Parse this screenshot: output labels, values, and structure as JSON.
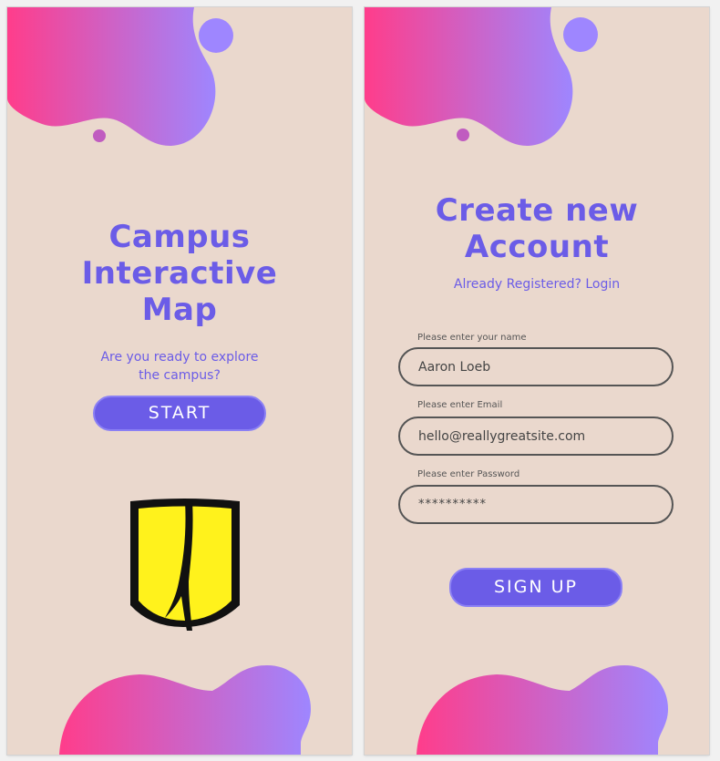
{
  "welcome_screen": {
    "title_lines": [
      "Campus",
      "Interactive",
      "Map"
    ],
    "subtitle_lines": [
      "Are you ready to explore",
      "the campus?"
    ],
    "start_button": "START",
    "logo_icon": "university-shield-logo"
  },
  "signup_screen": {
    "title_lines": [
      "Create new",
      "Account"
    ],
    "login_link": "Already Registered? Login",
    "fields": [
      {
        "label": "Please enter your name",
        "value": "Aaron Loeb"
      },
      {
        "label": "Please enter Email",
        "value": "hello@reallygreatsite.com"
      },
      {
        "label": "Please enter Password",
        "value": "**********"
      }
    ],
    "signup_button": "SIGN UP"
  },
  "colors": {
    "background": "#ead8cd",
    "accent": "#6b5ce7",
    "gradient_start": "#ff3d8b",
    "gradient_end": "#9e86ff",
    "logo_yellow": "#fff21c"
  }
}
